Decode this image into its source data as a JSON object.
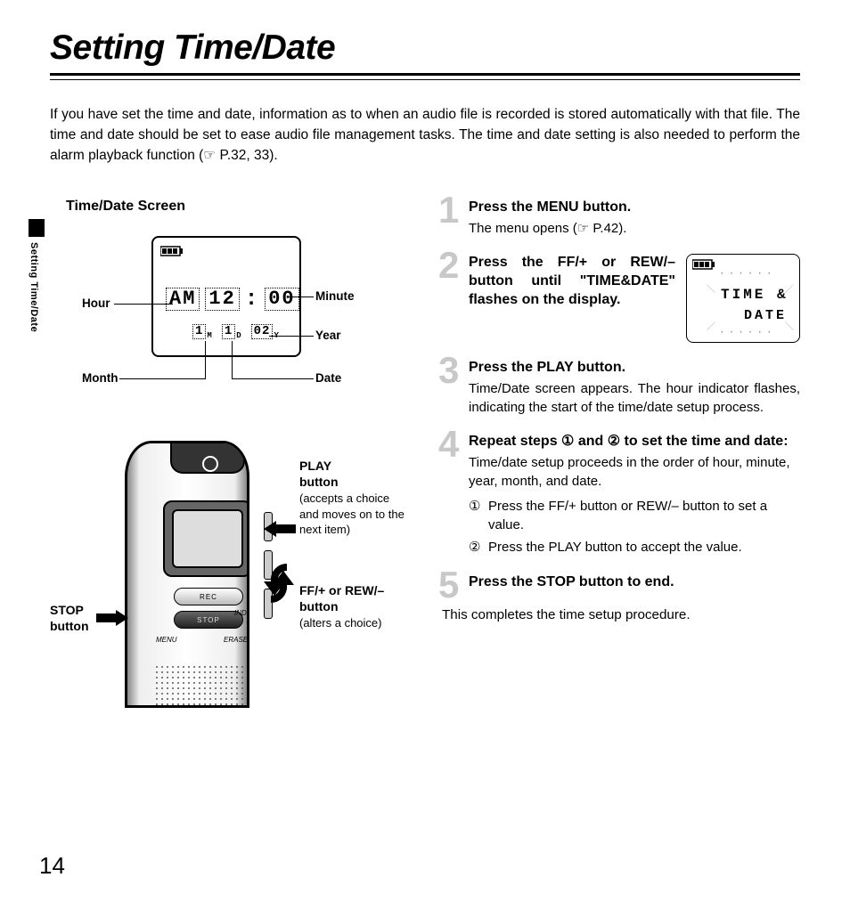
{
  "title": "Setting Time/Date",
  "side_tab": "Setting Time/Date",
  "intro": "If you have set the time and date, information as to when an audio file is recorded is stored automatically with that file. The time and date should be set to ease audio file management tasks. The time and date setting is also needed to perform the alarm playback function (☞ P.32, 33).",
  "left": {
    "heading": "Time/Date Screen",
    "lcd": {
      "ampm": "AM",
      "hour": "12",
      "sep": ":",
      "minute": "00",
      "month": "1",
      "m_mark": "M",
      "date": "1",
      "d_mark": "D",
      "year": "02",
      "y_mark": "Y"
    },
    "callouts": {
      "hour": "Hour",
      "minute": "Minute",
      "year": "Year",
      "month": "Month",
      "date": "Date"
    },
    "device": {
      "rec": "REC",
      "stop": "STOP",
      "index": "INDEX",
      "menu": "MENU",
      "erase": "ERASE",
      "stop_label_title": "STOP",
      "stop_label_sub": "button",
      "play_label_title": "PLAY",
      "play_label_sub": "button",
      "play_label_desc": "(accepts a choice and moves on to the next item)",
      "ff_label_title": "FF/+ or REW/–",
      "ff_label_sub": "button",
      "ff_label_desc": "(alters a choice)"
    }
  },
  "steps": {
    "s1": {
      "num": "1",
      "title": "Press the MENU button.",
      "body": "The menu opens (☞ P.42)."
    },
    "s2": {
      "num": "2",
      "title": "Press the FF/+ or REW/– button until \"TIME&DATE\" flashes on the display.",
      "mini": {
        "line1": "TIME &",
        "line2": "DATE"
      }
    },
    "s3": {
      "num": "3",
      "title": "Press the PLAY button.",
      "body": "Time/Date screen appears. The hour indicator flashes, indicating the start of the time/date setup process."
    },
    "s4": {
      "num": "4",
      "title": "Repeat steps ① and ② to set the time and date:",
      "body": "Time/date setup proceeds in the order of hour, minute, year, month, and date.",
      "items": [
        {
          "mark": "①",
          "text": "Press the FF/+ button or REW/– button to set a value."
        },
        {
          "mark": "②",
          "text": "Press the PLAY button to accept the value."
        }
      ]
    },
    "s5": {
      "num": "5",
      "title": "Press the STOP button to end."
    }
  },
  "closing": "This completes the time setup procedure.",
  "page_number": "14"
}
